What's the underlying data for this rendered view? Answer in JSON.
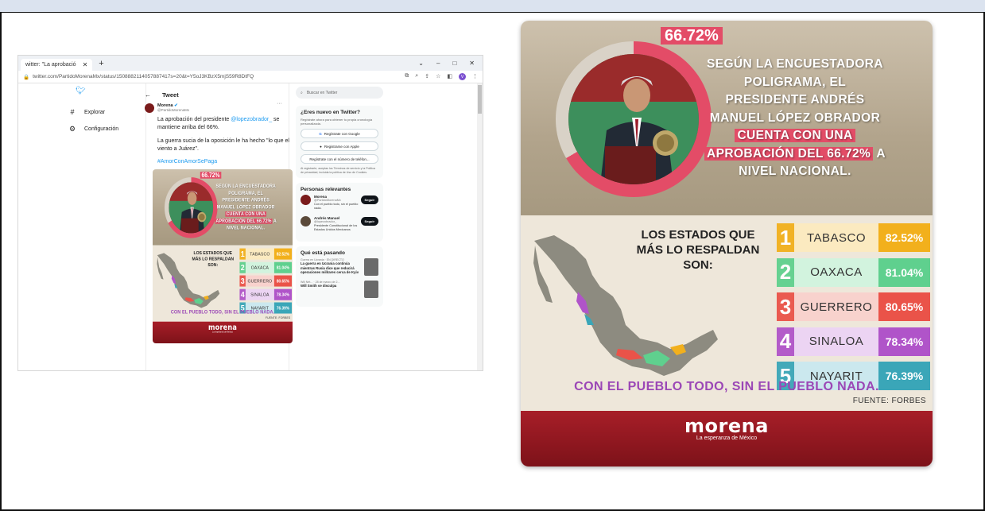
{
  "browser": {
    "tab_title": "witter: \"La aprobació",
    "url": "twitter.com/PartidoMorenaMx/status/1508882114057887417s=20&t=Y5oJ3KBzX5mjS59R8DtFQ",
    "window_controls": [
      "⌄",
      "–",
      "□",
      "✕"
    ]
  },
  "twitter": {
    "nav": [
      {
        "icon": "#",
        "label": "Explorar"
      },
      {
        "icon": "⚙",
        "label": "Configuración"
      }
    ],
    "feed_title": "Tweet",
    "post": {
      "name": "Morena",
      "handle": "@PartidoMorenaMx",
      "text_before": "La aprobación del presidente ",
      "mention": "@lopezobrador_",
      "text_after": " se mantiene arriba del 66%.",
      "text2": "La guerra sucia de la oposición le ha hecho \"lo que el viento a Juárez\".",
      "hashtag": "#AmorConAmorSePaga"
    },
    "search_placeholder": "Buscar en Twitter",
    "new_card": {
      "title": "¿Eres nuevo en Twitter?",
      "subtitle": "Regístrate ahora para obtener tu propia cronología personalizada.",
      "google": "Regístrate con Google",
      "apple": "Registrarse con Apple",
      "phone": "Regístrate con el número de teléfon...",
      "legal": "Al registrarte, aceptas los Términos de servicio y la Política de privacidad, incluida la política de Uso de Cookies."
    },
    "relevant": {
      "title": "Personas relevantes",
      "follow": "Seguir",
      "people": [
        {
          "name": "Morena",
          "handle": "@PartidoMorenaMx",
          "bio": "Con el pueblo todo, sin el pueblo nada."
        },
        {
          "name": "Andrés Manuel",
          "handle": "@lopezobrador_",
          "bio": "Presidente Constitucional de los Estados Unidos Mexicanos"
        }
      ]
    },
    "happening": {
      "title": "Qué está pasando",
      "items": [
        {
          "meta": "Guerra en Ucrania · EN DIRECTO",
          "text": "La guerra en Ucrania continúa mientras Rusia dice que reducirá operaciones militares cerca de Kyiv"
        },
        {
          "meta": "Will Nét... · 28 de marzo de 2...",
          "text": "Will Smith se disculpa"
        }
      ]
    }
  },
  "infographic": {
    "percentage": "66.72%",
    "headline_lines": [
      {
        "text": "SEGÚN LA ENCUESTADORA",
        "hl": false
      },
      {
        "text": "POLIGRAMA, EL",
        "hl": false
      },
      {
        "text": "PRESIDENTE ANDRÉS",
        "hl": false
      },
      {
        "text": "MANUEL LÓPEZ OBRADOR",
        "hl": false
      },
      {
        "text": "CUENTA CON UNA",
        "hl": true
      },
      {
        "text": "APROBACIÓN DEL 66.72%",
        "hl": true,
        "tail": " A"
      },
      {
        "text": "NIVEL NACIONAL.",
        "hl": false
      }
    ],
    "states_title": "LOS ESTADOS QUE MÁS LO RESPALDAN SON:",
    "states": [
      {
        "rank": "1",
        "name": "TABASCO",
        "value": "82.52%",
        "color": "#f2b01c",
        "light": "#fbeac0"
      },
      {
        "rank": "2",
        "name": "OAXACA",
        "value": "81.04%",
        "color": "#5fd08e",
        "light": "#d2f3de"
      },
      {
        "rank": "3",
        "name": "GUERRERO",
        "value": "80.65%",
        "color": "#ea5349",
        "light": "#f8d2cd"
      },
      {
        "rank": "4",
        "name": "SINALOA",
        "value": "78.34%",
        "color": "#b054c9",
        "light": "#ecd4f3"
      },
      {
        "rank": "5",
        "name": "NAYARIT",
        "value": "76.39%",
        "color": "#3aa6b8",
        "light": "#cbe8ee"
      }
    ],
    "slogan": "CON EL PUEBLO TODO, SIN EL PUEBLO NADA.",
    "source": "FUENTE: FORBES",
    "logo_word": "morena",
    "logo_tagline": "La esperanza de México",
    "ring_color": "#e34c67"
  }
}
